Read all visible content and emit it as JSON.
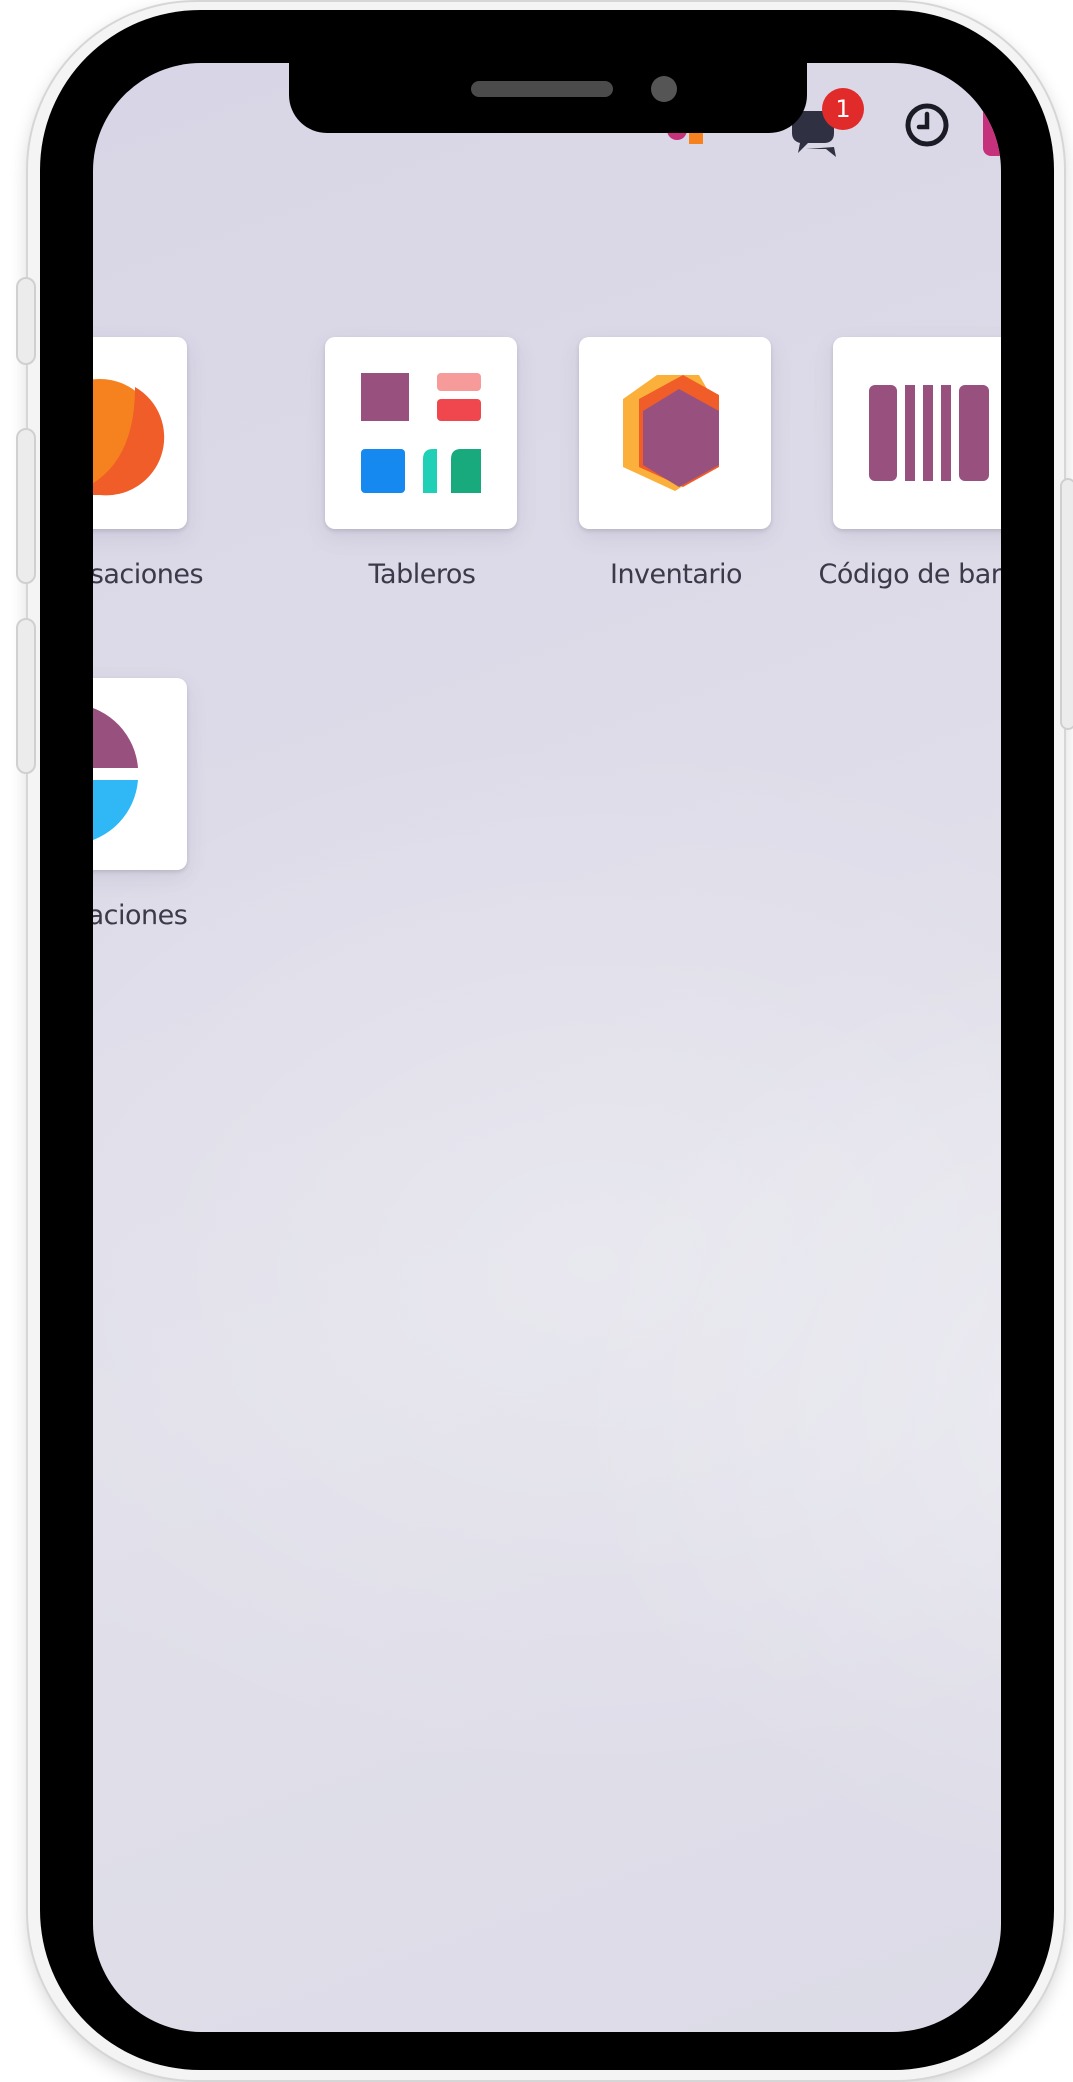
{
  "header": {
    "notification_count": "1",
    "icons": [
      "user-group-icon",
      "chat-icon",
      "clock-icon",
      "avatar"
    ]
  },
  "apps": [
    {
      "label": "onversaciones",
      "icon": "chat-bubble-icon"
    },
    {
      "label": "Tableros",
      "icon": "dashboard-icon"
    },
    {
      "label": "Inventario",
      "icon": "cube-icon"
    },
    {
      "label": "Código de barr",
      "icon": "barcode-icon"
    },
    {
      "label": "Aplicaciones",
      "icon": "apps-icon"
    }
  ],
  "colors": {
    "purple": "#98517f",
    "orange": "#f6821f",
    "red": "#f0474f",
    "blue": "#1589f0",
    "teal": "#1fcfb6",
    "badge": "#e12a2a"
  }
}
